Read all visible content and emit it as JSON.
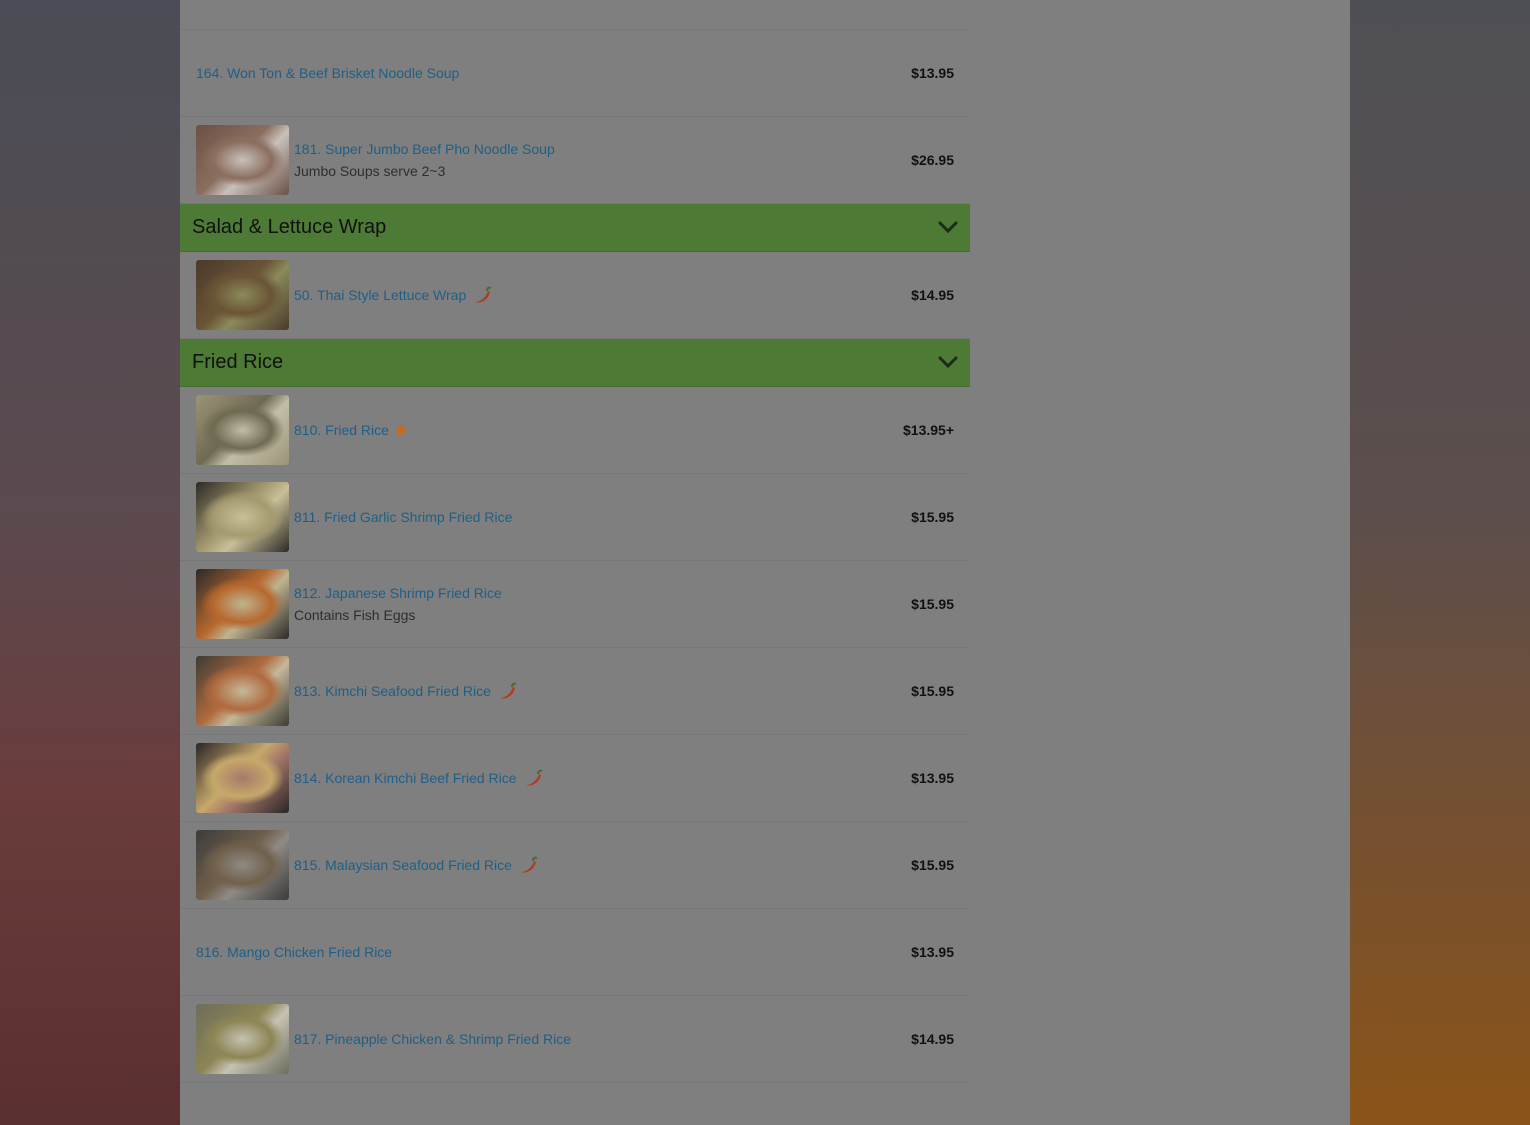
{
  "sections": [
    {
      "type": "items",
      "items": [
        {
          "name": "",
          "desc": "",
          "price": "",
          "image": false,
          "icon": null,
          "top": true
        },
        {
          "name": "164. Won Ton & Beef Brisket Noodle Soup",
          "desc": "",
          "price": "$13.95",
          "image": false,
          "icon": null
        },
        {
          "name": "181. Super Jumbo Beef Pho Noodle Soup",
          "desc": "Jumbo Soups serve 2~3",
          "price": "$26.95",
          "image": true,
          "icon": null,
          "colors": [
            "#6b5146",
            "#c9c1bb",
            "#8a6e5e"
          ]
        }
      ]
    },
    {
      "type": "category",
      "title": "Salad & Lettuce Wrap",
      "items": [
        {
          "name": "50. Thai Style Lettuce Wrap",
          "desc": "",
          "price": "$14.95",
          "image": true,
          "icon": "chili-icon",
          "colors": [
            "#4b3a2a",
            "#8b8a5a",
            "#6a5436"
          ]
        }
      ]
    },
    {
      "type": "category",
      "title": "Fried Rice",
      "items": [
        {
          "name": "810. Fried Rice",
          "desc": "",
          "price": "$13.95+",
          "image": true,
          "icon": "star-icon",
          "colors": [
            "#9a9479",
            "#c2bea6",
            "#6f6a52"
          ]
        },
        {
          "name": "811. Fried Garlic Shrimp Fried Rice",
          "desc": "",
          "price": "$15.95",
          "image": true,
          "icon": null,
          "colors": [
            "#2c2a26",
            "#c9bf98",
            "#a59a6f"
          ]
        },
        {
          "name": "812. Japanese Shrimp Fried Rice",
          "desc": "Contains Fish Eggs",
          "price": "$15.95",
          "image": true,
          "icon": null,
          "colors": [
            "#2a2a2a",
            "#bfb390",
            "#b7682d"
          ]
        },
        {
          "name": "813. Kimchi Seafood Fried Rice",
          "desc": "",
          "price": "$15.95",
          "image": true,
          "icon": "chili-icon",
          "colors": [
            "#3d3b35",
            "#c4b89a",
            "#b06a3e"
          ]
        },
        {
          "name": "814. Korean Kimchi Beef Fried Rice",
          "desc": "",
          "price": "$13.95",
          "image": true,
          "icon": "chili-icon",
          "colors": [
            "#2a2526",
            "#a6796a",
            "#c6a86a"
          ]
        },
        {
          "name": "815. Malaysian Seafood Fried Rice",
          "desc": "",
          "price": "$15.95",
          "image": true,
          "icon": "chili-icon",
          "colors": [
            "#3b3b3b",
            "#8f8a84",
            "#70604b"
          ]
        },
        {
          "name": "816. Mango Chicken Fried Rice",
          "desc": "",
          "price": "$13.95",
          "image": false,
          "icon": null
        },
        {
          "name": "817. Pineapple Chicken & Shrimp Fried Rice",
          "desc": "",
          "price": "$14.95",
          "image": true,
          "icon": null,
          "colors": [
            "#6d6d5c",
            "#c5c2b2",
            "#8c8555"
          ]
        }
      ]
    }
  ],
  "colors": {
    "category_bg": "#4d7a35",
    "item_link": "#1f5f87",
    "star": "#c8691c",
    "chili": "#b33a1c"
  }
}
